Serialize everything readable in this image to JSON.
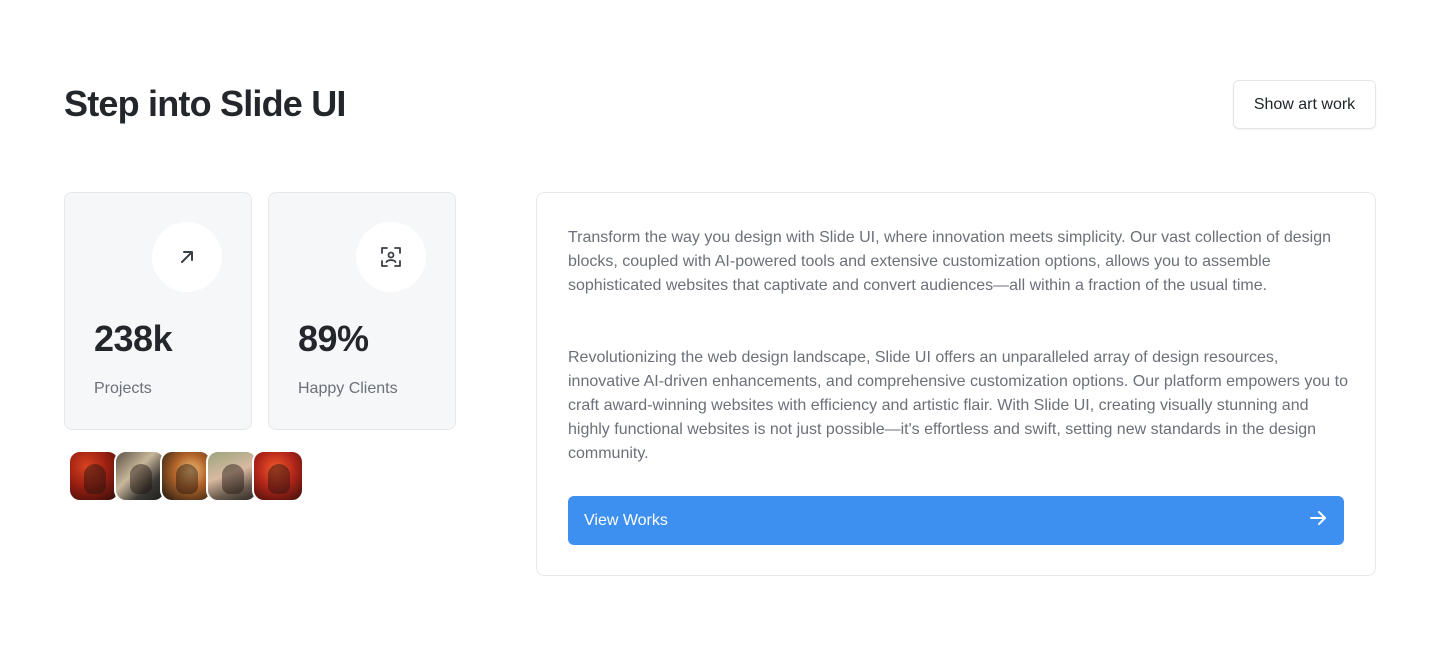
{
  "header": {
    "title": "Step into Slide UI",
    "show_art_label": "Show art work"
  },
  "stats": [
    {
      "value": "238k",
      "label": "Projects",
      "icon": "arrow-up-right-icon"
    },
    {
      "value": "89%",
      "label": "Happy Clients",
      "icon": "scan-user-icon"
    }
  ],
  "avatars": [
    "avatar-1",
    "avatar-2",
    "avatar-3",
    "avatar-4",
    "avatar-5"
  ],
  "content": {
    "paragraph_1": "Transform the way you design with Slide UI, where innovation meets simplicity. Our vast collection of design blocks, coupled with AI-powered tools and extensive customization options, allows you to assemble sophisticated websites that captivate and convert audiences—all within a fraction of the usual time.",
    "paragraph_2": "Revolutionizing the web design landscape, Slide UI offers an unparalleled array of design resources, innovative AI-driven enhancements, and comprehensive customization options. Our platform empowers you to craft award-winning websites with efficiency and artistic flair. With Slide UI, creating visually stunning and highly functional websites is not just possible—it's effortless and swift, setting new standards in the design community.",
    "cta_label": "View Works",
    "cta_icon": "arrow-right-icon"
  },
  "colors": {
    "accent": "#3d8ff0",
    "card_bg": "#f6f7f9",
    "text_primary": "#23272c",
    "text_muted": "#6b7079"
  }
}
